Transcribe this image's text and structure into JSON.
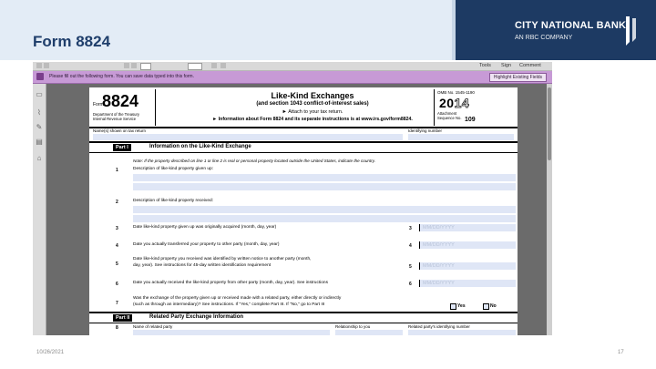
{
  "slide": {
    "title": "Form 8824",
    "bank_name": "CITY NATIONAL BANK",
    "bank_tagline": "AN RBC COMPANY",
    "footer_date": "10/26/2021",
    "page_number": "17"
  },
  "viewer": {
    "toolbar": {
      "tools_label": "Tools",
      "sign_label": "Sign",
      "comment_label": "Comment"
    },
    "notice": {
      "text": "Please fill out the following form. You can save data typed into this form.",
      "highlight_button": "Highlight Existing Fields"
    },
    "side_icons": [
      "pages-icon",
      "attachments-icon",
      "signatures-icon",
      "layers-icon",
      "tags-icon"
    ]
  },
  "form": {
    "form_word": "Form",
    "number": "8824",
    "department": "Department of the Treasury Internal Revenue Service",
    "title": "Like-Kind Exchanges",
    "subtitle": "(and section 1043 conflict-of-interest sales)",
    "attach": "► Attach to your tax return.",
    "info": "► Information about Form 8824 and its separate instructions is at www.irs.gov/form8824.",
    "omb": "OMB No. 1545-1190",
    "year_prefix": "20",
    "year_suffix": "14",
    "attachment_label": "Attachment Sequence No.",
    "sequence_no": "109",
    "name_label": "Name(s) shown on tax return",
    "id_label": "Identifying number",
    "part1_tag": "Part I",
    "part1_title": "Information on the Like-Kind Exchange",
    "note": "Note: If the property described on line 1 or line 2 is real or personal property located outside the United States, indicate the country.",
    "lines": [
      {
        "no": "1",
        "text": "Description of like-kind property given up:"
      },
      {
        "no": "2",
        "text": "Description of like-kind property received:"
      },
      {
        "no": "3",
        "text": "Date like-kind property given up was originally acquired (month, day, year)",
        "entry": "3",
        "placeholder": "MM/DD/YYYY"
      },
      {
        "no": "4",
        "text": "Date you actually transferred your property to other party (month, day, year)",
        "entry": "4",
        "placeholder": "MM/DD/YYYY"
      },
      {
        "no": "5",
        "text": "Date like-kind property you received was identified by written notice to another party (month,",
        "text2": "day, year). See instructions for 45-day written identification requirement",
        "entry": "5",
        "placeholder": "MM/DD/YYYY"
      },
      {
        "no": "6",
        "text": "Date you actually received the like-kind property from other party (month, day, year). See instructions",
        "entry": "6",
        "placeholder": "MM/DD/YYYY"
      },
      {
        "no": "7",
        "text": "Was the exchange of the property given up or received made with a related party, either directly or indirectly",
        "text2": "(such as through an intermediary)? See instructions. If \"Yes,\" complete Part III. If \"No,\" go to Part III"
      }
    ],
    "yes_label": "Yes",
    "no_label": "No",
    "part2_tag": "Part II",
    "part2_title": "Related Party Exchange Information",
    "line8_no": "8",
    "line8_name": "Name of related party",
    "line8_relationship": "Relationship to you",
    "line8_id": "Related party's identifying number"
  }
}
